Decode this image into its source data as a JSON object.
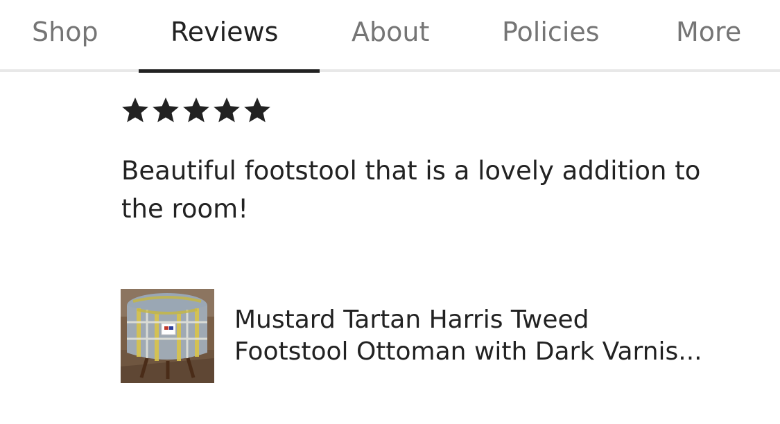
{
  "tabs": [
    {
      "label": "Shop",
      "active": false
    },
    {
      "label": "Reviews",
      "active": true
    },
    {
      "label": "About",
      "active": false
    },
    {
      "label": "Policies",
      "active": false
    },
    {
      "label": "More",
      "active": false
    }
  ],
  "review": {
    "rating": 5,
    "rating_max": 5,
    "text": "Beautiful footstool that is a lovely addition to the room!"
  },
  "listing": {
    "title_line1": "Mustard Tartan Harris Tweed",
    "title_line2": "Footstool Ottoman with Dark Varnis...",
    "thumbnail_icon": "footstool-product-photo"
  },
  "colors": {
    "text_primary": "#222222",
    "text_secondary": "#757575",
    "tab_indicator": "#222222",
    "divider": "#e8e8e8",
    "star": "#222222"
  }
}
